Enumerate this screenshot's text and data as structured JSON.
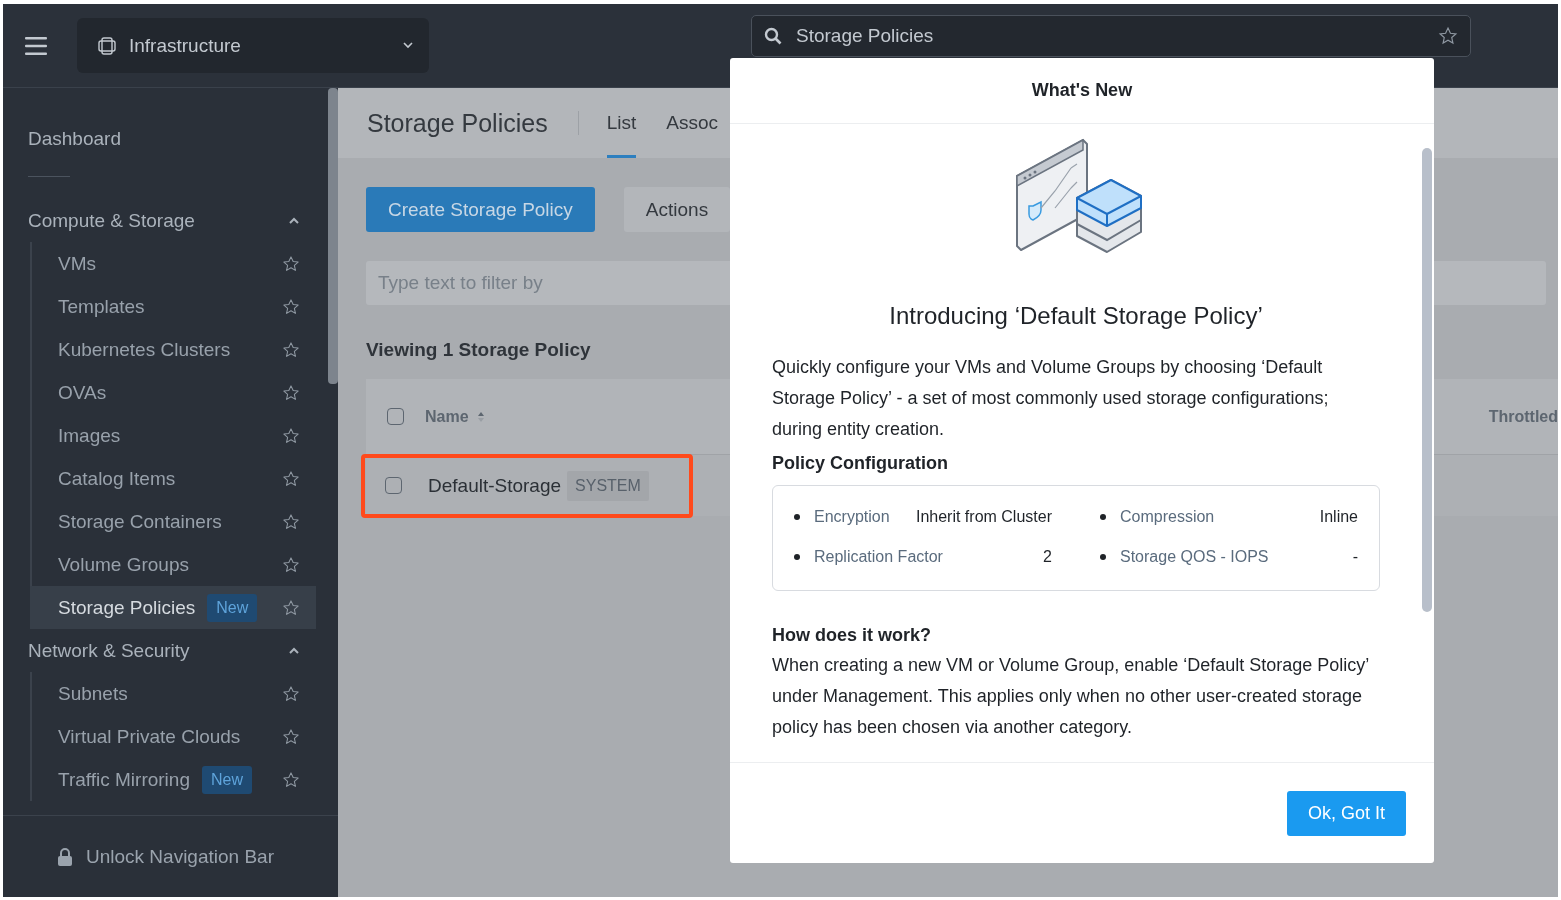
{
  "topbar": {
    "app_switcher": "Infrastructure",
    "search": {
      "value": "Storage Policies"
    }
  },
  "sidebar": {
    "items": [
      {
        "kind": "link",
        "label": "Dashboard"
      },
      {
        "kind": "group",
        "label": "Compute & Storage",
        "expanded": true,
        "children": [
          {
            "label": "VMs",
            "selected": false
          },
          {
            "label": "Templates",
            "selected": false
          },
          {
            "label": "Kubernetes Clusters",
            "selected": false
          },
          {
            "label": "OVAs",
            "selected": false
          },
          {
            "label": "Images",
            "selected": false
          },
          {
            "label": "Catalog Items",
            "selected": false
          },
          {
            "label": "Storage Containers",
            "selected": false
          },
          {
            "label": "Volume Groups",
            "selected": false
          },
          {
            "label": "Storage Policies",
            "selected": true,
            "badge": "New"
          }
        ]
      },
      {
        "kind": "group",
        "label": "Network & Security",
        "expanded": true,
        "children": [
          {
            "label": "Subnets",
            "selected": false
          },
          {
            "label": "Virtual Private Clouds",
            "selected": false
          },
          {
            "label": "Traffic Mirroring",
            "selected": false,
            "badge": "New"
          }
        ]
      }
    ],
    "footer": "Unlock Navigation Bar"
  },
  "page": {
    "title": "Storage Policies",
    "tabs": [
      {
        "label": "List",
        "selected": true
      },
      {
        "label": "Assoc",
        "selected": false
      }
    ],
    "primary_button": "Create Storage Policy",
    "secondary_button": "Actions",
    "filter": {
      "placeholder": "Type text to filter by"
    },
    "count": "Viewing 1 Storage Policy",
    "table": {
      "select_all_checked": false,
      "columns": [
        "Name",
        "Throttled"
      ],
      "rows": [
        {
          "name": "Default-Storage",
          "tag": "SYSTEM",
          "checked": false,
          "highlighted": true
        }
      ]
    }
  },
  "modal": {
    "title": "What's New",
    "heading": "Introducing ‘Default Storage Policy’",
    "intro": "Quickly configure your VMs and Volume Groups by choosing ‘Default Storage Policy’ - a set of most commonly used storage configurations; during entity creation.",
    "config_title": "Policy Configuration",
    "config": [
      {
        "label": "Encryption",
        "value": "Inherit from Cluster"
      },
      {
        "label": "Compression",
        "value": "Inline"
      },
      {
        "label": "Replication Factor",
        "value": "2"
      },
      {
        "label": "Storage QOS - IOPS",
        "value": "-"
      }
    ],
    "how_title": "How does it work?",
    "how_text": "When creating a new VM or Volume Group, enable ‘Default Storage Policy’ under Management. This applies only when no other user-created storage policy has been chosen via another category.",
    "button": "Ok, Got It"
  }
}
